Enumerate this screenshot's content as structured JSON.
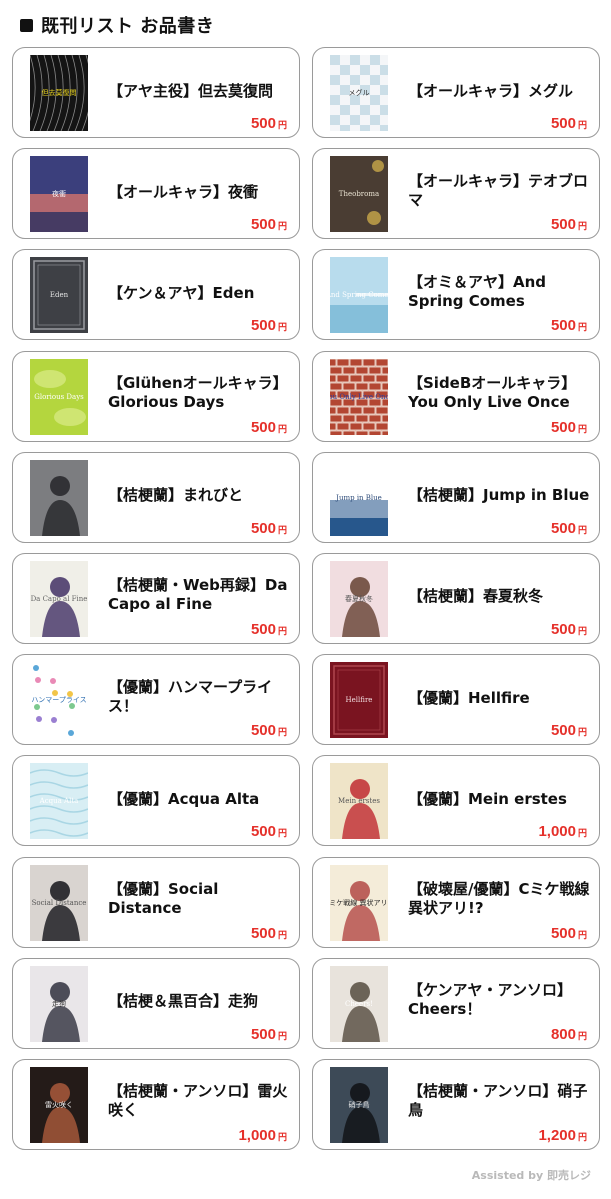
{
  "header": {
    "title": "既刊リスト お品書き",
    "icon": "black-square"
  },
  "currency_unit": "円",
  "books": [
    {
      "title": "【アヤ主役】但去莫復問",
      "price": "500",
      "cover": {
        "style": "lace",
        "bg": "#141414",
        "fg": "#d8d8d8",
        "text": "但去莫復問",
        "text_color": "#e8d21f"
      }
    },
    {
      "title": "【オールキャラ】メグル",
      "price": "500",
      "cover": {
        "style": "checker",
        "bg": "#f4f6f8",
        "fg": "#7fb3c8",
        "text": "メグル",
        "text_color": "#333333"
      }
    },
    {
      "title": "【オールキャラ】夜衝",
      "price": "500",
      "cover": {
        "style": "sunset",
        "bg": "#3b3f7c",
        "fg": "#e87a6a",
        "text": "夜衝",
        "text_color": "#ffffff"
      }
    },
    {
      "title": "【オールキャラ】テオブロマ",
      "price": "500",
      "cover": {
        "style": "plain-rose",
        "bg": "#4a3d33",
        "fg": "#c9a94a",
        "text": "Theobroma",
        "text_color": "#e9e2d2"
      }
    },
    {
      "title": "【ケン＆アヤ】Eden",
      "price": "500",
      "cover": {
        "style": "frame",
        "bg": "#3e4045",
        "fg": "#9a9ca2",
        "text": "Eden",
        "text_color": "#e6e6e6"
      }
    },
    {
      "title": "【オミ＆アヤ】And Spring Comes",
      "price": "500",
      "cover": {
        "style": "sky",
        "bg": "#b8dced",
        "fg": "#ffffff",
        "text": "And Spring Comes",
        "text_color": "#ffffff"
      }
    },
    {
      "title": "【Glühenオールキャラ】Glorious Days",
      "price": "500",
      "cover": {
        "style": "leaf",
        "bg": "#b4d63e",
        "fg": "#e9f3a6",
        "text": "Glorious Days",
        "text_color": "#ffffff"
      }
    },
    {
      "title": "【SideBオールキャラ】You Only Live Once",
      "price": "500",
      "cover": {
        "style": "brick",
        "bg": "#c6513a",
        "fg": "#f0e6dc",
        "text": "You Only Live Once",
        "text_color": "#2d3c9a"
      }
    },
    {
      "title": "【桔梗蘭】まれびと",
      "price": "500",
      "cover": {
        "style": "figure",
        "bg": "#7c7d80",
        "fg": "#2a2a2e",
        "text": "",
        "text_color": "#ffffff"
      }
    },
    {
      "title": "【桔梗蘭】Jump in Blue",
      "price": "500",
      "cover": {
        "style": "fade-blue",
        "bg": "#ffffff",
        "fg": "#1d4f86",
        "text": "Jump in Blue",
        "text_color": "#2e4c7a"
      }
    },
    {
      "title": "【桔梗蘭・Web再録】Da Capo al Fine",
      "price": "500",
      "cover": {
        "style": "figure",
        "bg": "#f0efe8",
        "fg": "#4b3b6c",
        "text": "Da Capo al Fine",
        "text_color": "#666666"
      }
    },
    {
      "title": "【桔梗蘭】春夏秋冬",
      "price": "500",
      "cover": {
        "style": "figure",
        "bg": "#f1dde0",
        "fg": "#6d4a3c",
        "text": "春夏秋冬",
        "text_color": "#555555"
      }
    },
    {
      "title": "【優蘭】ハンマープライス！",
      "price": "500",
      "cover": {
        "style": "gems",
        "bg": "#ffffff",
        "fg": "#5aa7d8",
        "text": "ハンマープライス",
        "text_color": "#2f6fb1"
      }
    },
    {
      "title": "【優蘭】Hellfire",
      "price": "500",
      "cover": {
        "style": "frame",
        "bg": "#7a1420",
        "fg": "#b0474f",
        "text": "Hellfire",
        "text_color": "#f1dde0"
      }
    },
    {
      "title": "【優蘭】Acqua Alta",
      "price": "500",
      "cover": {
        "style": "water",
        "bg": "#d8eef4",
        "fg": "#a9d6e4",
        "text": "Acqua Alta",
        "text_color": "#ffffff"
      }
    },
    {
      "title": "【優蘭】Mein erstes",
      "price": "1,000",
      "cover": {
        "style": "figure",
        "bg": "#efe4c8",
        "fg": "#c2353a",
        "text": "Mein erstes",
        "text_color": "#555555"
      }
    },
    {
      "title": "【優蘭】Social Distance",
      "price": "500",
      "cover": {
        "style": "figure",
        "bg": "#d9d4d0",
        "fg": "#1f1f24",
        "text": "Social Distance",
        "text_color": "#555555"
      }
    },
    {
      "title": "【破壊屋/優蘭】Cミケ戦線 異状アリ!?",
      "price": "500",
      "cover": {
        "style": "figure",
        "bg": "#f4ecd9",
        "fg": "#b6524d",
        "text": "Cミケ戦線 異状アリ!?",
        "text_color": "#222222"
      }
    },
    {
      "title": "【桔梗＆黒百合】走狗",
      "price": "500",
      "cover": {
        "style": "figure",
        "bg": "#e9e6e9",
        "fg": "#3b3b48",
        "text": "走狗",
        "text_color": "#333333"
      }
    },
    {
      "title": "【ケンアヤ・アンソロ】Cheers！",
      "price": "800",
      "cover": {
        "style": "figure",
        "bg": "#e8e3dc",
        "fg": "#5d5448",
        "text": "Cheers!",
        "text_color": "#ffffff"
      }
    },
    {
      "title": "【桔梗蘭・アンソロ】雷火咲く",
      "price": "1,000",
      "cover": {
        "style": "figure",
        "bg": "#241b18",
        "fg": "#a3573a",
        "text": "雷火咲く",
        "text_color": "#f2f2f2"
      }
    },
    {
      "title": "【桔梗蘭・アンソロ】硝子鳥",
      "price": "1,200",
      "cover": {
        "style": "figure",
        "bg": "#3d4a57",
        "fg": "#121418",
        "text": "硝子鳥",
        "text_color": "#e7e7e7"
      }
    }
  ],
  "footer": {
    "text": "Assisted by 即売レジ"
  }
}
